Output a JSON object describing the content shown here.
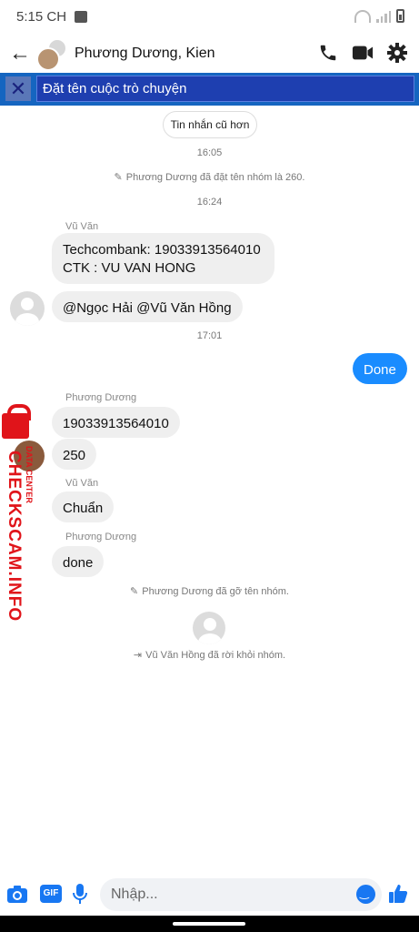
{
  "status_bar": {
    "time": "5:15 CH"
  },
  "header": {
    "title": "Phương Dương, Kien"
  },
  "rename": {
    "placeholder": "Đặt tên cuộc trò chuyện"
  },
  "older_button": "Tin nhắn cũ hơn",
  "timestamps": [
    "16:05",
    "16:24",
    "17:01"
  ],
  "system_messages": [
    "Phương Dương đã đặt tên nhóm là 260.",
    "Phương Dương đã gỡ tên nhóm.",
    "Vũ Văn Hồng đã rời khỏi nhóm."
  ],
  "messages": [
    {
      "sender": "Vũ Văn",
      "lines": [
        "Techcombank: 19033913564010",
        "CTK : VU VAN HONG"
      ]
    },
    {
      "text": "@Ngọc Hải @Vũ Văn Hồng"
    },
    {
      "text": "Done",
      "outgoing": true
    },
    {
      "sender": "Phương Dương",
      "text": "19033913564010"
    },
    {
      "text": "250"
    },
    {
      "sender": "Vũ Văn",
      "text": "Chuẩn"
    },
    {
      "sender": "Phương Dương",
      "text": "done"
    }
  ],
  "watermark": {
    "main": "CHECKSCAM.INFO",
    "sub": "DATA CENTER"
  },
  "composer": {
    "placeholder": "Nhập...",
    "gif_label": "GIF"
  },
  "colors": {
    "accent": "#1877f2",
    "rename_bar": "#1565c0",
    "watermark": "#e0141a"
  }
}
